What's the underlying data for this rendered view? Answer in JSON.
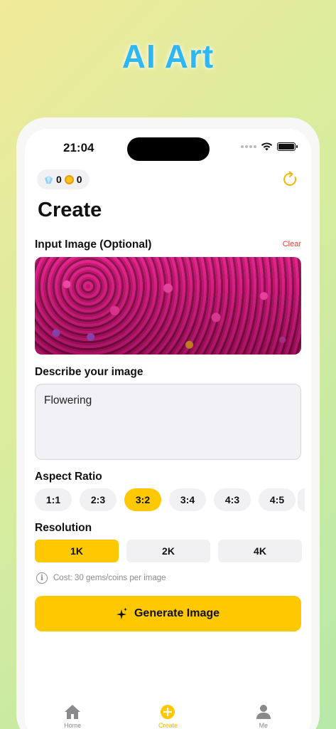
{
  "promo": {
    "title": "AI Art"
  },
  "status_bar": {
    "time": "21:04"
  },
  "balance": {
    "gems": "0",
    "coins": "0"
  },
  "page": {
    "title": "Create"
  },
  "input_image": {
    "label": "Input Image (Optional)",
    "clear_label": "Clear"
  },
  "description": {
    "label": "Describe your image",
    "value": "Flowering"
  },
  "aspect_ratio": {
    "label": "Aspect Ratio",
    "options": [
      "1:1",
      "2:3",
      "3:2",
      "3:4",
      "4:3",
      "4:5"
    ],
    "selected": "3:2"
  },
  "resolution": {
    "label": "Resolution",
    "options": [
      "1K",
      "2K",
      "4K"
    ],
    "selected": "1K"
  },
  "cost_note": "Cost: 30 gems/coins per image",
  "generate_label": "Generate Image",
  "tabs": [
    {
      "label": "Home",
      "icon": "house-icon"
    },
    {
      "label": "Create",
      "icon": "plus-circle-icon"
    },
    {
      "label": "Me",
      "icon": "person-icon"
    }
  ],
  "colors": {
    "accent": "#FFC800",
    "clear": "#EF3B2D",
    "promo_title": "#2FB7F1"
  }
}
